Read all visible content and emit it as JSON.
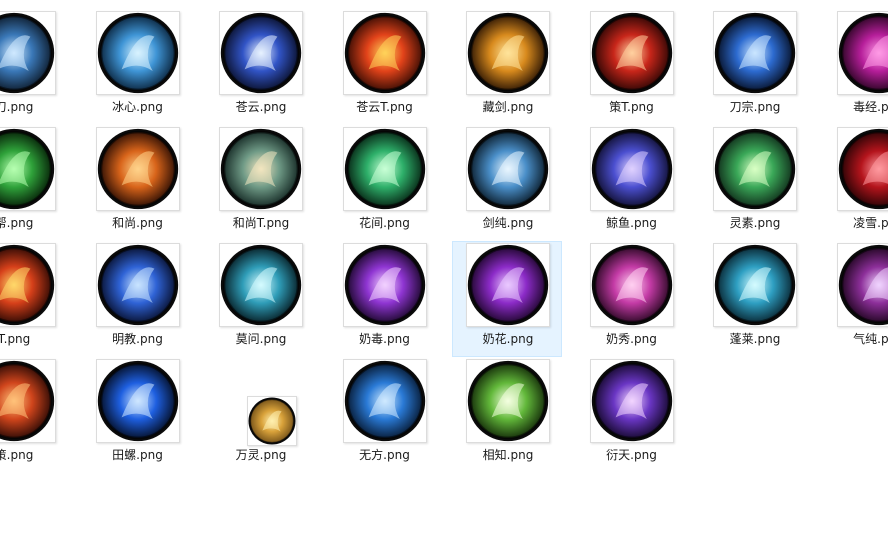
{
  "files": [
    {
      "name": "刀.png",
      "icon": "blade-icon",
      "colors": [
        "#cfe9ff",
        "#3a78b8",
        "#0a1522"
      ]
    },
    {
      "name": "冰心.png",
      "icon": "ice-heart-icon",
      "colors": [
        "#d8f3ff",
        "#3f95d6",
        "#061b30"
      ]
    },
    {
      "name": "苍云.png",
      "icon": "cloud-slash-icon",
      "colors": [
        "#e8f2ff",
        "#3154c6",
        "#070b1f"
      ]
    },
    {
      "name": "苍云T.png",
      "icon": "flame-shield-icon",
      "colors": [
        "#ffd35a",
        "#e2431a",
        "#2b0802"
      ]
    },
    {
      "name": "藏剑.png",
      "icon": "golden-sword-icon",
      "colors": [
        "#ffe39a",
        "#d88a1d",
        "#1e0c02"
      ]
    },
    {
      "name": "策T.png",
      "icon": "red-spear-icon",
      "colors": [
        "#ffd1a0",
        "#c8261a",
        "#220403"
      ]
    },
    {
      "name": "刀宗.png",
      "icon": "swordsman-icon",
      "colors": [
        "#cbe6ff",
        "#2d6bd0",
        "#040b1c"
      ]
    },
    {
      "name": "毒经.png",
      "icon": "poison-sigil-icon",
      "colors": [
        "#ff9ae6",
        "#b61e9a",
        "#1f0319"
      ]
    },
    {
      "name": "帮.png",
      "icon": "green-dancer-icon",
      "colors": [
        "#b6ffb0",
        "#2fa23a",
        "#031504"
      ]
    },
    {
      "name": "和尚.png",
      "icon": "meditating-monk-icon",
      "colors": [
        "#ffd38a",
        "#d8641a",
        "#1e0702"
      ]
    },
    {
      "name": "和尚T.png",
      "icon": "scroll-icon",
      "colors": [
        "#f3e6c0",
        "#6f9a86",
        "#0d1f1c"
      ]
    },
    {
      "name": "花间.png",
      "icon": "green-sage-icon",
      "colors": [
        "#c8ffd6",
        "#2eb06a",
        "#041a0e"
      ]
    },
    {
      "name": "剑纯.png",
      "icon": "taiji-icon",
      "colors": [
        "#e9f6ff",
        "#4a8fc9",
        "#06141f"
      ]
    },
    {
      "name": "鲸鱼.png",
      "icon": "violet-arrow-icon",
      "colors": [
        "#e0d2ff",
        "#4b4fd0",
        "#0b0a24"
      ]
    },
    {
      "name": "灵素.png",
      "icon": "leaf-icon",
      "colors": [
        "#d9ffc4",
        "#3aa858",
        "#0d2416"
      ]
    },
    {
      "name": "凌雪.png",
      "icon": "crimson-swirl-icon",
      "colors": [
        "#ff9aa0",
        "#b4141c",
        "#1c0203"
      ]
    },
    {
      "name": "T.png",
      "icon": "fire-body-icon",
      "colors": [
        "#ffd86a",
        "#d6401a",
        "#200502"
      ]
    },
    {
      "name": "明教.png",
      "icon": "blue-crescent-icon",
      "colors": [
        "#c9e4ff",
        "#2f63d6",
        "#050a22"
      ]
    },
    {
      "name": "莫问.png",
      "icon": "cyan-strings-icon",
      "colors": [
        "#d6fbff",
        "#2f9db8",
        "#041419"
      ]
    },
    {
      "name": "奶毒.png",
      "icon": "violet-fountain-icon",
      "colors": [
        "#f2d2ff",
        "#8f35d2",
        "#12041e"
      ]
    },
    {
      "name": "奶花.png",
      "icon": "purple-figure-icon",
      "colors": [
        "#eac9ff",
        "#8c2bc8",
        "#15031f"
      ]
    },
    {
      "name": "奶秀.png",
      "icon": "lotus-icon",
      "colors": [
        "#ffd0f0",
        "#c43ba6",
        "#1e0419"
      ]
    },
    {
      "name": "蓬莱.png",
      "icon": "wave-icon",
      "colors": [
        "#d5fbff",
        "#2e9fc2",
        "#061c26"
      ]
    },
    {
      "name": "气纯.png",
      "icon": "meditating-sage-icon",
      "colors": [
        "#f0d4ff",
        "#8d2f9a",
        "#170216"
      ]
    },
    {
      "name": "策.png",
      "icon": "burning-body-icon",
      "colors": [
        "#ffc27a",
        "#d0451c",
        "#1e0503"
      ]
    },
    {
      "name": "田螺.png",
      "icon": "blue-flame-icon",
      "colors": [
        "#cfe7ff",
        "#1e5fe0",
        "#020816"
      ]
    },
    {
      "name": "万灵.png",
      "icon": "golden-feather-icon",
      "colors": [
        "#fff0b0",
        "#d9a23a",
        "#6b4a16"
      ],
      "small": true
    },
    {
      "name": "无方.png",
      "icon": "blue-lotus-icon",
      "colors": [
        "#cfeaff",
        "#2a7ad6",
        "#041226"
      ]
    },
    {
      "name": "相知.png",
      "icon": "flower-blossom-icon",
      "colors": [
        "#f4ffe0",
        "#62b83a",
        "#0d1f05"
      ]
    },
    {
      "name": "衍天.png",
      "icon": "cosmic-ring-icon",
      "colors": [
        "#f2d6ff",
        "#6a36c4",
        "#0e0520"
      ]
    }
  ],
  "selected_index": 20
}
